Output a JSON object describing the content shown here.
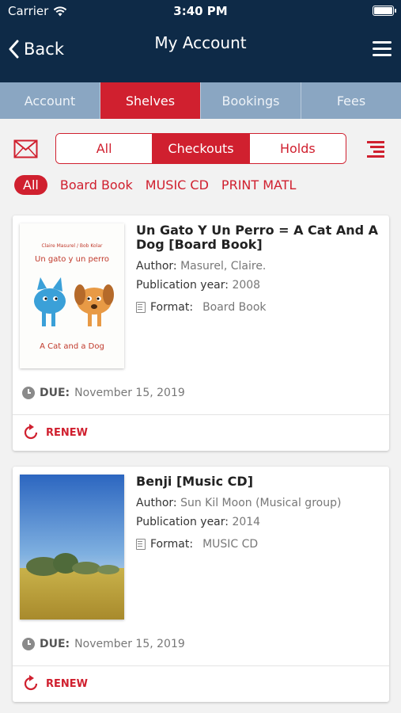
{
  "status_bar": {
    "carrier": "Carrier",
    "time": "3:40 PM"
  },
  "nav": {
    "back_label": "Back",
    "title": "My Account"
  },
  "tabs": [
    {
      "label": "Account"
    },
    {
      "label": "Shelves"
    },
    {
      "label": "Bookings"
    },
    {
      "label": "Fees"
    }
  ],
  "segments": [
    {
      "label": "All"
    },
    {
      "label": "Checkouts"
    },
    {
      "label": "Holds"
    }
  ],
  "chips": [
    {
      "label": "All"
    },
    {
      "label": "Board Book"
    },
    {
      "label": "MUSIC CD"
    },
    {
      "label": "PRINT MATL"
    }
  ],
  "items": [
    {
      "title": "Un Gato Y Un Perro = A Cat And A Dog [Board Book]",
      "author_label": "Author:",
      "author": "Masurel, Claire.",
      "year_label": "Publication year:",
      "year": "2008",
      "format_label": "Format:",
      "format": "Board Book",
      "due_label": "DUE:",
      "due": "November 15, 2019",
      "renew_label": "RENEW",
      "cover": {
        "authors_line": "Claire Masurel / Bob Kolar",
        "title_line": "Un gato y un perro",
        "subtitle_line": "A Cat and a Dog"
      }
    },
    {
      "title": "Benji [Music CD]",
      "author_label": "Author:",
      "author": "Sun Kil Moon (Musical group)",
      "year_label": "Publication year:",
      "year": "2014",
      "format_label": "Format:",
      "format": "MUSIC CD",
      "due_label": "DUE:",
      "due": "November 15, 2019",
      "renew_label": "RENEW"
    }
  ],
  "colors": {
    "header_bg": "#0e2a47",
    "accent": "#d0202f",
    "tab_bg": "#8aa6c2"
  },
  "icons": {
    "wifi": "wifi-icon",
    "battery": "battery-icon",
    "back": "chevron-left-icon",
    "menu": "hamburger-menu-icon",
    "mail": "mail-icon",
    "sort": "sort-icon",
    "format": "book-icon",
    "due": "clock-icon",
    "renew": "renew-icon"
  }
}
